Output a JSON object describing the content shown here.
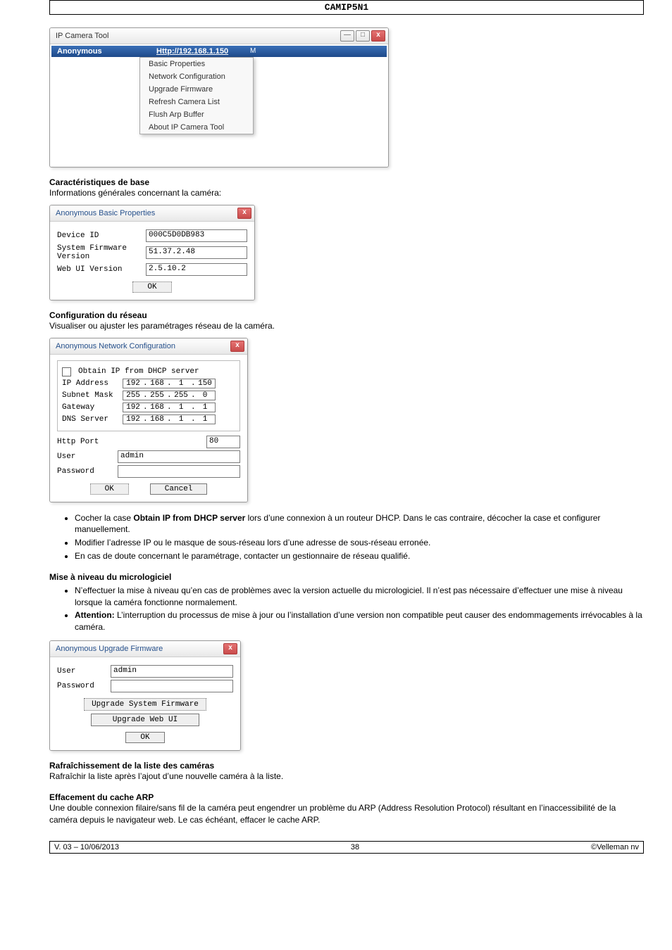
{
  "header": {
    "title": "CAMIP5N1"
  },
  "ipctool": {
    "window_title": "IP Camera Tool",
    "anon_label": "Anonymous",
    "http_url": "Http://192.168.1.150",
    "mark": "M",
    "menu": [
      "Basic Properties",
      "Network Configuration",
      "Upgrade Firmware",
      "Refresh Camera List",
      "Flush Arp Buffer",
      "About IP Camera Tool"
    ]
  },
  "s1": {
    "heading": "Caractéristiques de base",
    "intro": "Informations générales concernant la caméra:"
  },
  "basic_props": {
    "window_title": "Anonymous Basic Properties",
    "rows": {
      "device_id": {
        "label": "Device ID",
        "value": "000C5D0DB983"
      },
      "firmware": {
        "label": "System Firmware Version",
        "value": "51.37.2.48"
      },
      "webui": {
        "label": "Web UI Version",
        "value": "2.5.10.2"
      }
    },
    "ok": "OK"
  },
  "s2": {
    "heading": "Configuration du réseau",
    "intro": "Visualiser ou ajuster les paramétrages réseau de la caméra."
  },
  "netcfg": {
    "window_title": "Anonymous Network Configuration",
    "obtain_label": "Obtain IP from DHCP server",
    "rows": {
      "ip": {
        "label": "IP Address",
        "value": [
          "192",
          "168",
          "1",
          "150"
        ]
      },
      "subnet": {
        "label": "Subnet Mask",
        "value": [
          "255",
          "255",
          "255",
          "0"
        ]
      },
      "gateway": {
        "label": "Gateway",
        "value": [
          "192",
          "168",
          "1",
          "1"
        ]
      },
      "dns": {
        "label": "DNS Server",
        "value": [
          "192",
          "168",
          "1",
          "1"
        ]
      }
    },
    "http_port": {
      "label": "Http Port",
      "value": "80"
    },
    "user": {
      "label": "User",
      "value": "admin"
    },
    "password": {
      "label": "Password",
      "value": ""
    },
    "ok": "OK",
    "cancel": "Cancel"
  },
  "s2_list": {
    "i1a": "Cocher la case ",
    "i1b": "Obtain IP from DHCP server",
    "i1c": " lors d’une connexion à un routeur DHCP. Dans le cas contraire, décocher la case et configurer manuellement.",
    "i2": "Modifier l’adresse IP ou le masque de sous-réseau lors d’une adresse de sous-réseau erronée.",
    "i3": "En cas de doute concernant le paramétrage, contacter un gestionnaire de réseau qualifié."
  },
  "s3": {
    "heading": "Mise à niveau du micrologiciel",
    "i1": "N’effectuer la mise à niveau qu’en cas de problèmes avec la version actuelle du micrologiciel. Il n’est pas nécessaire d’effectuer une mise à niveau lorsque la caméra fonctionne normalement.",
    "i2a": "Attention:",
    "i2b": " L’interruption du processus de mise à jour ou l’installation d’une version non compatible peut causer des endommagements irrévocables à la caméra."
  },
  "upgrade": {
    "window_title": "Anonymous Upgrade Firmware",
    "user": {
      "label": "User",
      "value": "admin"
    },
    "password": {
      "label": "Password",
      "value": ""
    },
    "btn1": "Upgrade System Firmware",
    "btn2": "Upgrade Web UI",
    "ok": "OK"
  },
  "s4": {
    "heading": "Rafraîchissement de la liste des caméras",
    "text": "Rafraîchir la liste après l’ajout d’une nouvelle caméra à la liste."
  },
  "s5": {
    "heading": "Effacement du cache ARP",
    "text": "Une double connexion filaire/sans fil de la caméra peut engendrer un problème du ARP (Address Resolution Protocol) résultant en l’inaccessibilité de la caméra depuis le navigateur web. Le cas échéant, effacer le cache ARP."
  },
  "footer": {
    "left": "V. 03 – 10/06/2013",
    "center": "38",
    "right": "©Velleman nv"
  }
}
